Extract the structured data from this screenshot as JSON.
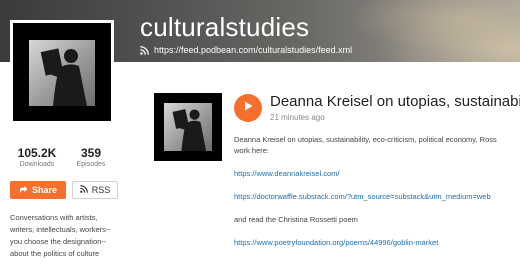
{
  "header": {
    "title": "culturalstudies",
    "feed_url": "https://feed.podbean.com/culturalstudies/feed.xml"
  },
  "stats": {
    "downloads_value": "105.2K",
    "downloads_label": "Downloads",
    "episodes_value": "359",
    "episodes_label": "Episodes"
  },
  "actions": {
    "share_label": "Share",
    "rss_label": "RSS"
  },
  "sidebar": {
    "description": "Conversations with artists, writers, intellectuals, workers--you choose the designation--about the politics of culture"
  },
  "episode": {
    "title": "Deanna Kreisel on utopias, sustainability",
    "time": "21 minutes ago",
    "summary_line1": "Deanna Kreisel on utopias, sustainability, eco-criticism, political economy, Ross",
    "summary_line2": "work here:",
    "link1": "https://www.deannakreisel.com/",
    "link2": "https://doctorwaffle.substack.com/?utm_source=substack&utm_medium=web",
    "text3": "and read the Christina Rossetti poem",
    "link3": "https://www.poetryfoundation.org/poems/44996/goblin-market"
  },
  "colors": {
    "accent": "#f4702c",
    "link": "#1a6fb3"
  }
}
